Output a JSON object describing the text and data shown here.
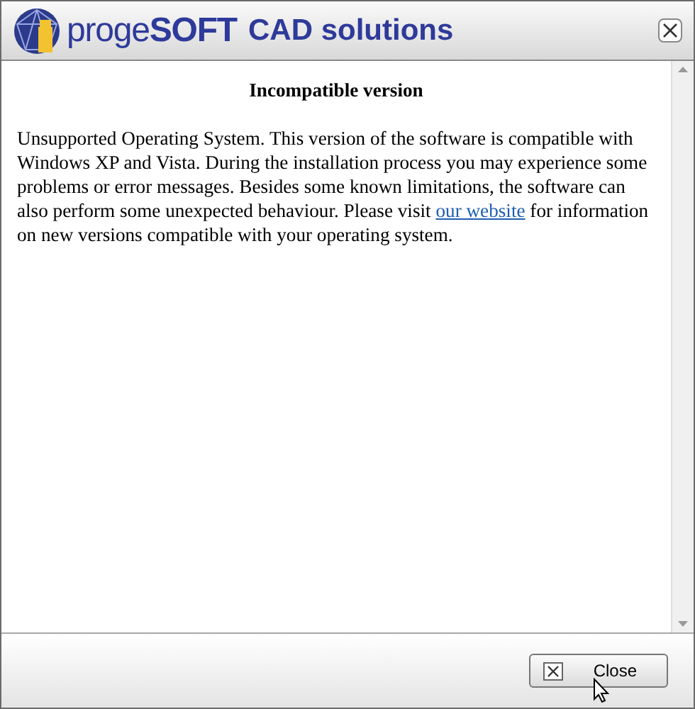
{
  "window": {
    "brand": "proge**SOFT**",
    "title": "CAD solutions"
  },
  "content": {
    "heading": "Incompatible version",
    "text_before": "Unsupported Operating System. This version of the software is compatible with Windows XP and Vista. During the installation process you may experience some problems or error messages. Besides some known limitations, the software can also perform some unexpected behaviour. Please visit",
    "link": "our website",
    "text_after": "for information on new versions compatible with your operating system."
  },
  "buttons": [
    {
      "label": "Close"
    }
  ]
}
